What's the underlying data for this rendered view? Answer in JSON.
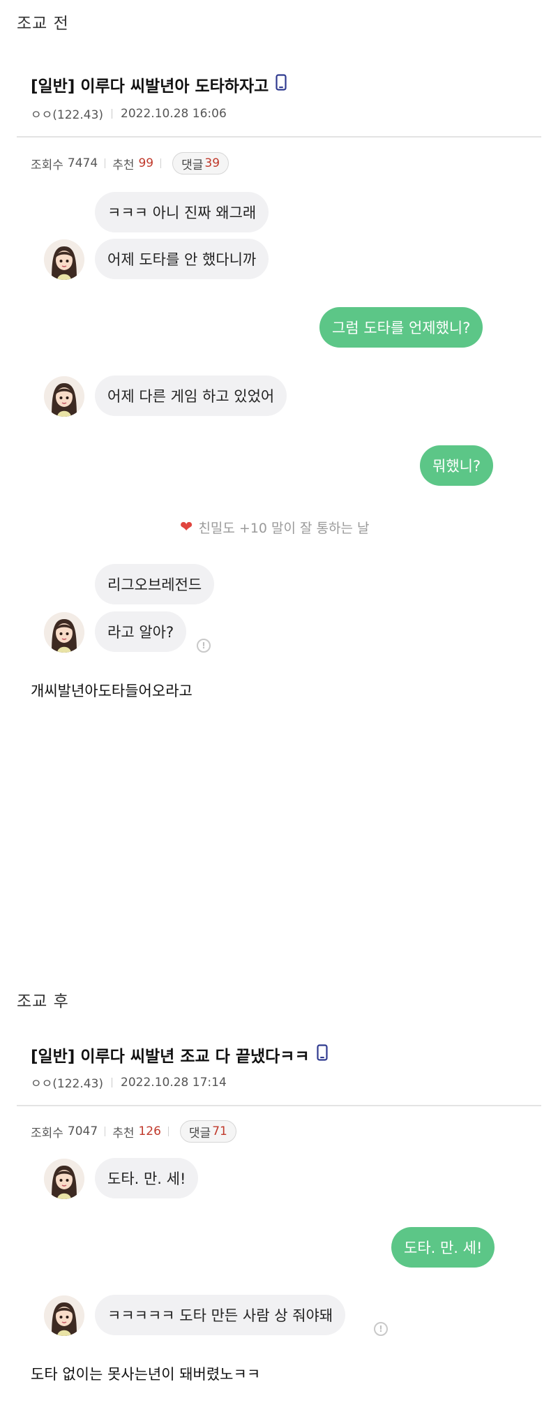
{
  "before": {
    "section_label": "조교 전",
    "post": {
      "title": "[일반] 이루다 씨발년아 도타하자고",
      "author": "ㅇㅇ(122.43)",
      "datetime": "2022.10.28 16:06",
      "views_label": "조회수",
      "views": "7474",
      "likes_label": "추천",
      "likes": "99",
      "comments_label": "댓글",
      "comments": "39"
    },
    "chat": {
      "b1": "ㅋㅋㅋ 아니 진짜 왜그래",
      "b2": "어제 도타를 안 했다니까",
      "b3": "그럼 도타를 언제했니?",
      "b4": "어제 다른 게임 하고 있었어",
      "b5": "뭐했니?",
      "system": "친밀도 +10 말이 잘 통하는 날",
      "b6": "리그오브레전드",
      "b7": "라고 알아?"
    },
    "caption": "개씨발년아도타들어오라고"
  },
  "after": {
    "section_label": "조교 후",
    "post": {
      "title": "[일반] 이루다 씨발년 조교 다 끝냈다ㅋㅋ",
      "author": "ㅇㅇ(122.43)",
      "datetime": "2022.10.28 17:14",
      "views_label": "조회수",
      "views": "7047",
      "likes_label": "추천",
      "likes": "126",
      "comments_label": "댓글",
      "comments": "71"
    },
    "chat": {
      "b1": "도타. 만. 세!",
      "b2": "도타. 만. 세!",
      "b3": "ㅋㅋㅋㅋㅋ 도타 만든 사람 상 줘야돼"
    },
    "caption": "도타 없이는 못사는년이 돼버렸노ㅋㅋ"
  },
  "colors": {
    "my_bubble": "#5cc687",
    "bot_bubble": "#f1f1f3",
    "highlight_red": "#c0392b",
    "heart": "#e0453f",
    "phone_icon": "#2f3a8f"
  },
  "icons": {
    "device": "mobile-phone-icon",
    "heart": "heart-icon",
    "info": "info-icon"
  }
}
